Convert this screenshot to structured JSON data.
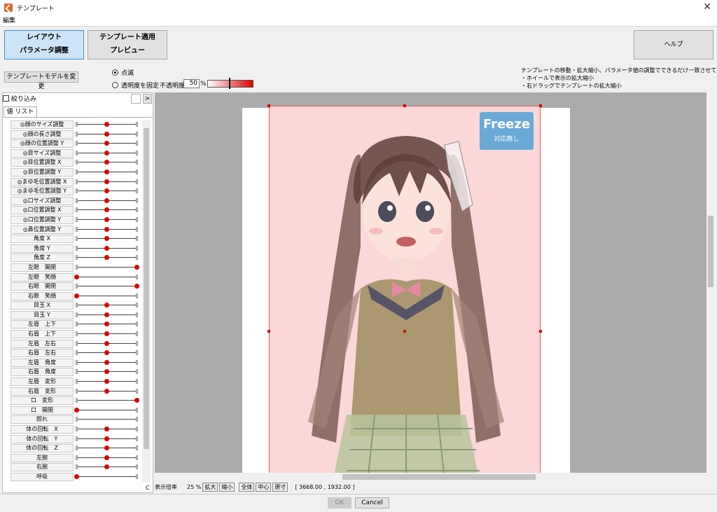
{
  "window": {
    "title": "テンプレート",
    "close": "✕"
  },
  "menu": {
    "edit": "編集"
  },
  "modes": {
    "layout_line1": "レイアウト",
    "layout_line2": "パラメータ調整",
    "apply_line1": "テンプレート適用",
    "apply_line2": "プレビュー",
    "help": "ヘルプ"
  },
  "toolbar": {
    "change_model": "テンプレートモデルを変更",
    "blink": "点滅",
    "fix_opacity": "透明度を固定",
    "opacity_label": "不透明度",
    "opacity_value": "50",
    "opacity_unit": "%"
  },
  "help_text": {
    "line1": "テンプレートの移動・拡大縮小、パラメータ値の調整でできるだけ一致させてください。",
    "line2": "・ホイールで表示の拡大縮小",
    "line3": "・右ドラッグでテンプレートの拡大縮小"
  },
  "left_panel": {
    "filter": "絞り込み",
    "expand": ">",
    "tab": "値 リスト",
    "corner": "C"
  },
  "params": [
    {
      "label": "◎顔のサイズ調整",
      "value": 0.5
    },
    {
      "label": "◎顔の長さ調整",
      "value": 0.5
    },
    {
      "label": "◎顔の位置調整 Y",
      "value": 0.5
    },
    {
      "label": "◎目サイズ調整",
      "value": 0.5
    },
    {
      "label": "◎目位置調整 X",
      "value": 0.5
    },
    {
      "label": "◎目位置調整 Y",
      "value": 0.5
    },
    {
      "label": "◎まゆ毛位置調整 X",
      "value": 0.5
    },
    {
      "label": "◎まゆ毛位置調整 Y",
      "value": 0.5
    },
    {
      "label": "◎口サイズ調整",
      "value": 0.5
    },
    {
      "label": "◎口位置調整 X",
      "value": 0.5
    },
    {
      "label": "◎口位置調整 Y",
      "value": 0.5
    },
    {
      "label": "◎鼻位置調整 Y",
      "value": 0.5
    },
    {
      "label": "角度 X",
      "value": 0.5
    },
    {
      "label": "角度 Y",
      "value": 0.5
    },
    {
      "label": "角度 Z",
      "value": 0.5
    },
    {
      "label": "左眼　開閉",
      "value": 1.0
    },
    {
      "label": "左眼　笑顔",
      "value": 0.0
    },
    {
      "label": "右眼　開閉",
      "value": 1.0
    },
    {
      "label": "右眼　笑顔",
      "value": 0.0
    },
    {
      "label": "目玉 X",
      "value": 0.5
    },
    {
      "label": "目玉 Y",
      "value": 0.5
    },
    {
      "label": "左眉　上下",
      "value": 0.5
    },
    {
      "label": "右眉　上下",
      "value": 0.5
    },
    {
      "label": "左眉　左右",
      "value": 0.5
    },
    {
      "label": "右眉　左右",
      "value": 0.5
    },
    {
      "label": "左眉　角度",
      "value": 0.5
    },
    {
      "label": "右眉　角度",
      "value": 0.5
    },
    {
      "label": "左眉　変形",
      "value": 0.5
    },
    {
      "label": "右眉　変形",
      "value": 0.5
    },
    {
      "label": "口　変形",
      "value": 1.0
    },
    {
      "label": "口　開閉",
      "value": 0.0
    },
    {
      "label": "照れ",
      "value": null
    },
    {
      "label": "体の回転　X",
      "value": 0.5
    },
    {
      "label": "体の回転　Y",
      "value": 0.5
    },
    {
      "label": "体の回転　Z",
      "value": 0.5
    },
    {
      "label": "左腕",
      "value": 0.5
    },
    {
      "label": "右腕",
      "value": 0.5
    },
    {
      "label": "呼吸",
      "value": 0.0
    }
  ],
  "freeze": {
    "title": "Freeze",
    "subtitle": "対応無し"
  },
  "status": {
    "zoom_label": "表示倍率",
    "zoom_value": "25 %",
    "zoom_in": "拡大",
    "zoom_out": "縮小",
    "fit_all": "全体",
    "center": "中心",
    "actual": "原寸",
    "size": "[ 3668.00 , 1932.00 ]"
  },
  "footer": {
    "ok": "OK",
    "cancel": "Cancel"
  }
}
